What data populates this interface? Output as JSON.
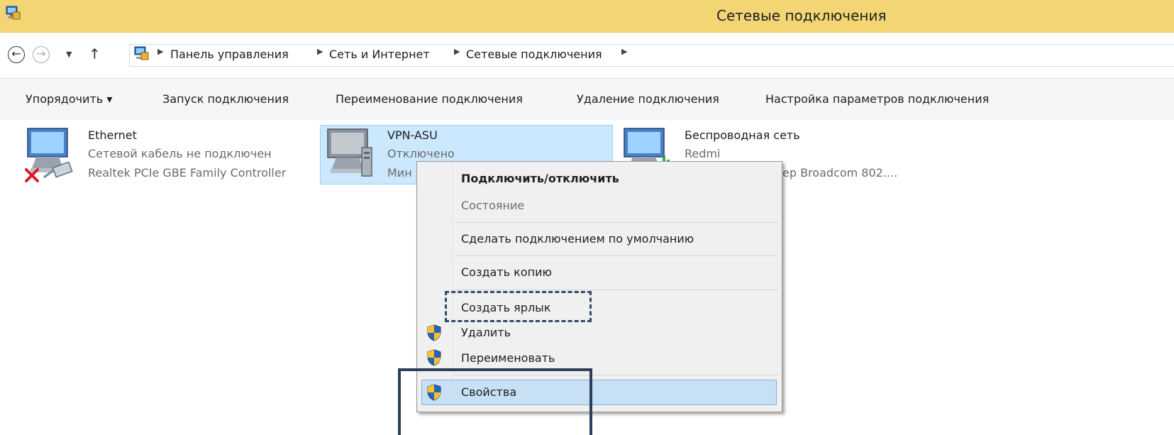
{
  "window": {
    "title": "Сетевые подключения",
    "icon": "network-connections-icon"
  },
  "address_bar": {
    "back_icon": "back-arrow-icon",
    "forward_icon": "forward-arrow-icon",
    "history_icon": "chevron-down-icon",
    "up_icon": "up-arrow-icon",
    "breadcrumbs": [
      "Панель управления",
      "Сеть и Интернет",
      "Сетевые подключения"
    ]
  },
  "command_bar": {
    "organize": "Упорядочить ▾",
    "start": "Запуск подключения",
    "rename": "Переименование подключения",
    "delete": "Удаление подключения",
    "settings": "Настройка параметров подключения"
  },
  "connections": [
    {
      "name": "Ethernet",
      "status": "Сетевой кабель не подключен",
      "adapter": "Realtek PCIe GBE Family Controller"
    },
    {
      "name": "VPN-ASU",
      "status": "Отключено",
      "adapter": "Мин"
    },
    {
      "name": "Беспроводная сеть",
      "status": "Redmi",
      "adapter": "ep Broadcom 802...."
    }
  ],
  "context_menu": {
    "items": [
      {
        "label": "Подключить/отключить"
      },
      {
        "label": "Состояние"
      },
      {
        "label": "Сделать подключением по умолчанию"
      },
      {
        "label": "Создать копию"
      },
      {
        "label": "Создать ярлык"
      },
      {
        "label": "Удалить"
      },
      {
        "label": "Переименовать"
      },
      {
        "label": "Свойства"
      }
    ]
  },
  "colors": {
    "title_bar": "#f3d574",
    "selection": "#cce8ff",
    "annotation": "#2b3f5c"
  }
}
